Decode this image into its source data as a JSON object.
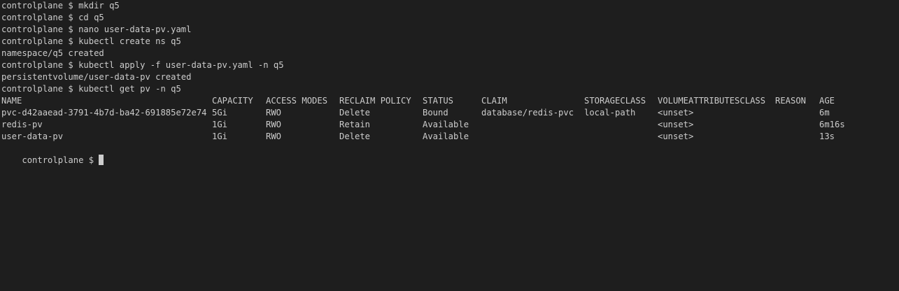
{
  "terminal": {
    "prompt": "controlplane $ ",
    "history": [
      {
        "type": "command",
        "text": "mkdir q5"
      },
      {
        "type": "command",
        "text": "cd q5"
      },
      {
        "type": "command",
        "text": "nano user-data-pv.yaml"
      },
      {
        "type": "command",
        "text": "kubectl create ns q5"
      },
      {
        "type": "output",
        "text": "namespace/q5 created"
      },
      {
        "type": "command",
        "text": "kubectl apply -f user-data-pv.yaml -n q5"
      },
      {
        "type": "output",
        "text": "persistentvolume/user-data-pv created"
      },
      {
        "type": "command",
        "text": "kubectl get pv -n q5"
      }
    ],
    "table": {
      "headers": [
        "NAME",
        "CAPACITY",
        "ACCESS MODES",
        "RECLAIM POLICY",
        "STATUS",
        "CLAIM",
        "STORAGECLASS",
        "VOLUMEATTRIBUTESCLASS",
        "REASON",
        "AGE"
      ],
      "rows": [
        [
          "pvc-d42aaead-3791-4b7d-ba42-691885e72e74",
          "5Gi",
          "RWO",
          "Delete",
          "Bound",
          "database/redis-pvc",
          "local-path",
          "<unset>",
          "",
          "6m"
        ],
        [
          "redis-pv",
          "1Gi",
          "RWO",
          "Retain",
          "Available",
          "",
          "",
          "<unset>",
          "",
          "6m16s"
        ],
        [
          "user-data-pv",
          "1Gi",
          "RWO",
          "Delete",
          "Available",
          "",
          "",
          "<unset>",
          "",
          "13s"
        ]
      ]
    },
    "current_input": ""
  },
  "colors": {
    "background": "#1e1e1e",
    "foreground": "#cccccc"
  }
}
